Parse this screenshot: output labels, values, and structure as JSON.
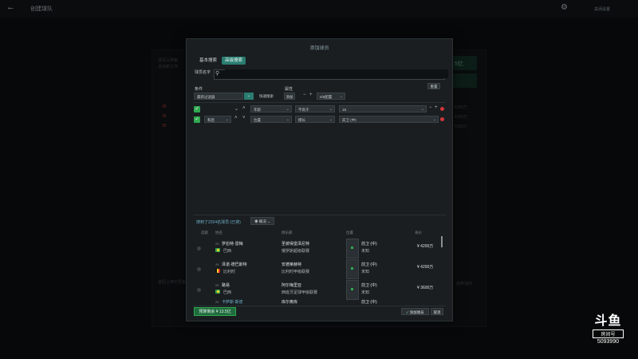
{
  "topbar": {
    "title": "创建球队",
    "settings_link": "关闭设置"
  },
  "background": {
    "intro_line1": "填写以搜索",
    "intro_line2": "添加新工作",
    "money": "5亿",
    "rows": [
      {
        "badge": "35",
        "value": "4350万"
      },
      {
        "badge": "35",
        "value": "4350万"
      },
      {
        "badge": "35",
        "value": "5350万"
      }
    ],
    "footer_left": "重回上帝的预备阵容",
    "footer_right": "放弃谈判"
  },
  "modal": {
    "title": "添加球员",
    "tabs": {
      "basic": "基本搜索",
      "advanced": "高级搜索"
    },
    "name_label": "球员名字",
    "name_placeholder": "",
    "conditions_label": "条件",
    "attributes_label": "属性",
    "reset_button": "重置",
    "filter_select": "最新过滤器",
    "quick_search": "快速搜索",
    "attr_add": "添加",
    "attr_count": "0/5配置",
    "filters": [
      {
        "field": "年龄",
        "op": "不高于",
        "value": "18"
      },
      {
        "prefix": "和后",
        "field": "位置",
        "op": "擅长",
        "value": "前卫 (中)"
      }
    ],
    "results_text": "搜到了2204名球员 (已排)",
    "view_button": "概况",
    "columns": {
      "select": "选取",
      "name": "姓名",
      "club": "俱乐部",
      "position": "位置",
      "value": "身价"
    },
    "players": [
      {
        "pos_num": "25",
        "name": "罗伯特·雷梅",
        "nationality": "巴西",
        "club": "圣彼得堡泽尼特",
        "league": "俄罗斯超级联赛",
        "position": "前卫 (中)",
        "status": "未知",
        "value": "¥ 4200万",
        "flag": "brazil"
      },
      {
        "pos_num": "25",
        "name": "泽诺·德巴斯特",
        "nationality": "比利时",
        "club": "安德莱赫特",
        "league": "比利时甲级联赛",
        "position": "前卫 (中)",
        "status": "未知",
        "value": "¥ 4200万",
        "flag": "belgium"
      },
      {
        "pos_num": "25",
        "name": "路易",
        "nationality": "巴西",
        "club": "阿尔梅里亚",
        "league": "西班牙足球甲级联赛",
        "position": "前卫 (中)",
        "status": "未知",
        "value": "¥ 3600万",
        "flag": "brazil"
      },
      {
        "pos_num": "25",
        "name": "卡萨斯·斯皮",
        "nationality": "",
        "club": "库尔奥库",
        "league": "",
        "position": "前卫 (中)",
        "status": "",
        "value": "",
        "flag": ""
      }
    ],
    "budget_button": "预算剩余 ¥ 13.5亿",
    "confirm_button": "添加球员",
    "cancel_button": "取消"
  },
  "watermark": {
    "logo": "斗鱼",
    "sub": "房间号",
    "room": "5093990"
  },
  "colors": {
    "accent": "#2a7d70",
    "check": "#2fa84f",
    "delete": "#d0363a",
    "link": "#6fb0c9"
  }
}
